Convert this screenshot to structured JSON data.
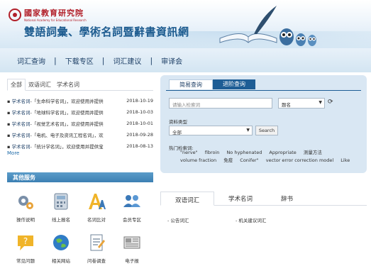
{
  "header": {
    "org_cn": "國家教育研究院",
    "org_en": "National Academy for Educational Research",
    "site_title": "雙語詞彙、學術名詞暨辭書資訊網"
  },
  "nav": {
    "items": [
      "词汇查询",
      "下载专区",
      "词汇建议",
      "审译会"
    ]
  },
  "news": {
    "tabs": [
      "全部",
      "双语词汇",
      "学术名词"
    ],
    "active_tab": "全部",
    "items": [
      {
        "kind": "学术名词",
        "text": "-「生命科学名词」，欢迎使用并提供",
        "date": "2018-10-19"
      },
      {
        "kind": "学术名词",
        "text": "-「地球科学名词」，欢迎使用并提供",
        "date": "2018-10-03"
      },
      {
        "kind": "学术名词",
        "text": "-「视觉艺术名词」，欢迎使用并提供",
        "date": "2018-10-01"
      },
      {
        "kind": "学术名词",
        "text": "-「电机、电子及资讯工程名词」，欢",
        "date": "2018-09-28"
      },
      {
        "kind": "学术名词",
        "text": "-「统计学名词」，欢迎使用并提供宝",
        "date": "2018-08-13"
      }
    ],
    "more_label": "More"
  },
  "services": {
    "title": "其他服务",
    "items": [
      {
        "label": "操作说明",
        "icon": "gears-icon"
      },
      {
        "label": "线上报名",
        "icon": "calculator-icon"
      },
      {
        "label": "名词比对",
        "icon": "font-icon"
      },
      {
        "label": "会员专区",
        "icon": "users-icon"
      },
      {
        "label": "常见问题",
        "icon": "question-icon"
      },
      {
        "label": "相关网站",
        "icon": "globe-icon"
      },
      {
        "label": "问卷调查",
        "icon": "survey-icon"
      },
      {
        "label": "电子报",
        "icon": "newspaper-icon"
      }
    ]
  },
  "search": {
    "tabs": [
      "简易查询",
      "进阶查询"
    ],
    "keyword_placeholder": "请输入检索词",
    "field_value": "题名",
    "type_label": "资料类型",
    "type_value": "全部",
    "search_button": "Search",
    "hot_label": "热门检索词:",
    "hot_terms": [
      "\"nerve\"",
      "fibroin",
      "No hyphenated",
      "Appropriate",
      "测量方法",
      "volume fraction",
      "免疫",
      "Conifer\"",
      "vector error correction model",
      "Like"
    ]
  },
  "lower": {
    "tabs": [
      "双语词汇",
      "学术名词",
      "辞书"
    ],
    "links": [
      "- 公告词汇",
      "- 机关建议词汇"
    ]
  },
  "colors": {
    "brand_red": "#b2202a",
    "nav_text": "#1d3f66",
    "tab_dark": "#1d5d95",
    "services_bar": "#3c80b3"
  }
}
